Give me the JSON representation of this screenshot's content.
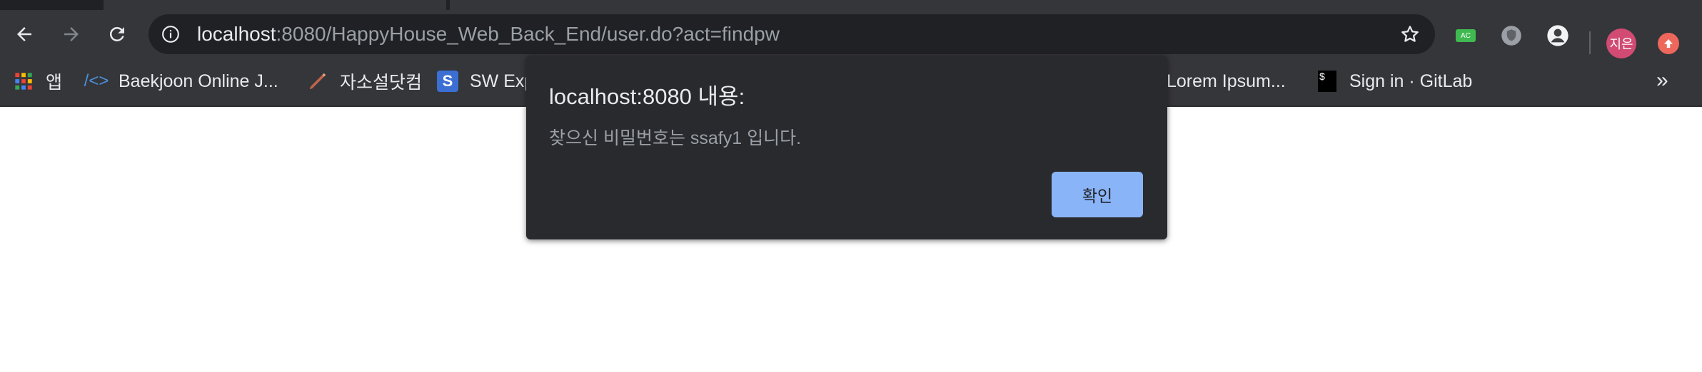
{
  "browser": {
    "url_host": "localhost",
    "url_rest": ":8080/HappyHouse_Web_Back_End/user.do?act=findpw",
    "profile_initials": "지은",
    "extensions": [
      "ac-extension-icon",
      "shield-extension-icon",
      "avatar-extension-icon"
    ],
    "ext_ac_label": "AC"
  },
  "bookmarks": {
    "items": [
      {
        "label": "앱",
        "icon": "apps-grid-icon"
      },
      {
        "label": "Baekjoon Online J...",
        "icon": "code-brackets-icon"
      },
      {
        "label": "자소설닷컴",
        "icon": "pen-icon"
      },
      {
        "label": "SW Exp",
        "icon": "s-logo-icon"
      },
      {
        "label": "Lorem Ipsum...",
        "icon": "none"
      },
      {
        "label": "Sign in · GitLab",
        "icon": "terminal-icon"
      }
    ],
    "more_label": "»"
  },
  "dialog": {
    "title": "localhost:8080 내용:",
    "message": "찾으신 비밀번호는 ssafy1 입니다.",
    "ok_label": "확인"
  },
  "colors": {
    "toolbar": "#35363a",
    "omnibox": "#202124",
    "dialog_bg": "#292a2d",
    "button_accent": "#8ab4f8",
    "profile": "#d14b73"
  }
}
